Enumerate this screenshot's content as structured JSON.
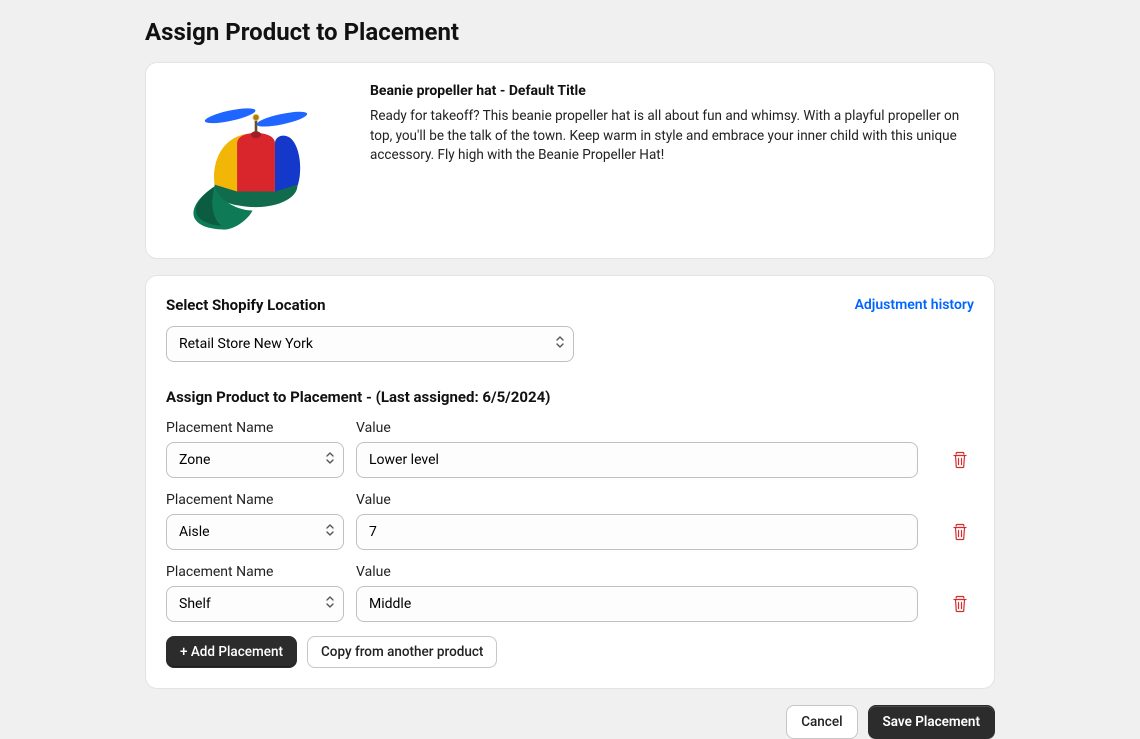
{
  "page_title": "Assign Product to Placement",
  "product": {
    "title": "Beanie propeller hat - Default Title",
    "description": "Ready for takeoff? This beanie propeller hat is all about fun and whimsy. With a playful propeller on top, you'll be the talk of the town. Keep warm in style and embrace your inner child with this unique accessory. Fly high with the Beanie Propeller Hat!"
  },
  "location": {
    "label": "Select Shopify Location",
    "selected": "Retail Store New York",
    "adjustment_link": "Adjustment history"
  },
  "assign_section_title": "Assign Product to Placement - (Last assigned: 6/5/2024)",
  "placement_name_label": "Placement Name",
  "value_label": "Value",
  "placements": [
    {
      "name": "Zone",
      "value": "Lower level"
    },
    {
      "name": "Aisle",
      "value": "7"
    },
    {
      "name": "Shelf",
      "value": "Middle"
    }
  ],
  "buttons": {
    "add_placement": "+ Add Placement",
    "copy_from": "Copy from another product",
    "cancel": "Cancel",
    "save": "Save Placement"
  }
}
